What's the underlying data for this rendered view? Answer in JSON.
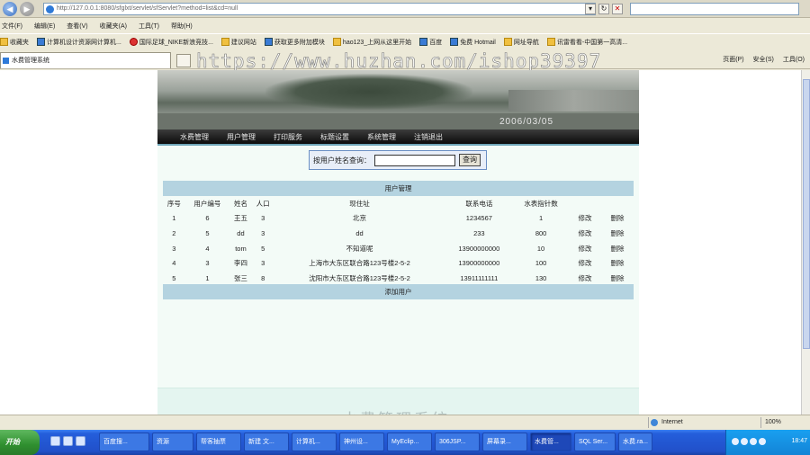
{
  "browser": {
    "address": "http://127.0.0.1:8080/sfglxt/servlet/sfServlet?method=list&cd=null",
    "search_placeholder": "",
    "menu": [
      "文件(F)",
      "编辑(E)",
      "查看(V)",
      "收藏夹(A)",
      "工具(T)",
      "帮助(H)"
    ],
    "favorites_label": "收藏夹",
    "favorites": [
      "计算机设计资源网计算机...",
      "国际足球_NIKE新浪竞技...",
      "建议网站",
      "获取更多附加模块",
      "hao123_上网从这里开始",
      "百度",
      "免费 Hotmail",
      "网址导航",
      "讯雷看看-中国第一高清..."
    ],
    "tab_title": "水费管理系统",
    "commands": [
      "页面(P)",
      "安全(S)",
      "工具(O)"
    ],
    "watermark": "https://www.huzhan.com/ishop39397"
  },
  "site": {
    "banner_date": "2006/03/05",
    "nav": [
      "水费管理",
      "用户管理",
      "打印服务",
      "标题设置",
      "系统管理",
      "注销退出"
    ],
    "search_label": "按用户姓名查询：",
    "search_value": "",
    "search_button": "查询",
    "table_caption": "用户管理",
    "columns": [
      "序号",
      "用户编号",
      "姓名",
      "人口",
      "现住址",
      "联系电话",
      "水表指针数",
      "",
      ""
    ],
    "rows": [
      [
        "1",
        "6",
        "王五",
        "3",
        "北京",
        "1234567",
        "1",
        "修改",
        "删除"
      ],
      [
        "2",
        "5",
        "dd",
        "3",
        "dd",
        "233",
        "800",
        "修改",
        "删除"
      ],
      [
        "3",
        "4",
        "tom",
        "5",
        "不知道呢",
        "13900000000",
        "10",
        "修改",
        "删除"
      ],
      [
        "4",
        "3",
        "李四",
        "3",
        "上海市大东区联合路123号楼2-5-2",
        "13900000000",
        "100",
        "修改",
        "删除"
      ],
      [
        "5",
        "1",
        "张三",
        "8",
        "沈阳市大东区联合路123号楼2-5-2",
        "13911111111",
        "130",
        "修改",
        "删除"
      ]
    ],
    "add_user": "添加用户",
    "footer_title": "水费管理系统"
  },
  "status": {
    "zone": "Internet",
    "zoom": "100%"
  },
  "taskbar": {
    "start": "开始",
    "tasks": [
      "百度搜...",
      "资源",
      "帮客抽票",
      "新建 文...",
      "计算机...",
      "神州设...",
      "MyEclip...",
      "306JSP...",
      "屏幕录...",
      "水费管...",
      "SQL Ser...",
      "水费.ra..."
    ],
    "active_index": 9,
    "clock": "18:47"
  }
}
